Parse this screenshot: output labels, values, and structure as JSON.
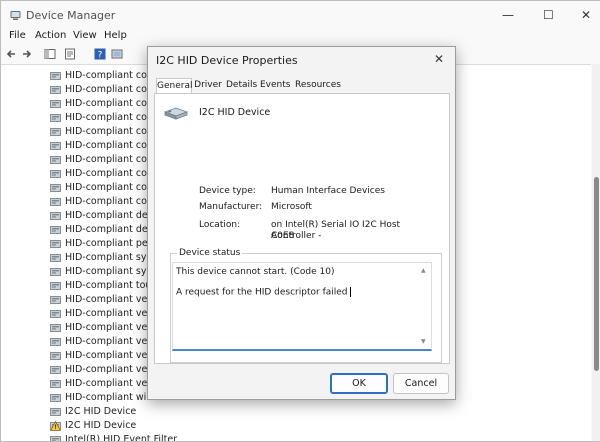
{
  "window": {
    "title": "Device Manager",
    "minimize_icon": "—",
    "maximize_icon": "☐",
    "close_icon": "✕"
  },
  "menu": [
    "File",
    "Action",
    "View",
    "Help"
  ],
  "tree_rows": [
    {
      "label": "HID-compliant consu",
      "warning": false
    },
    {
      "label": "HID-compliant consu",
      "warning": false
    },
    {
      "label": "HID-compliant consu",
      "warning": false
    },
    {
      "label": "HID-compliant consu",
      "warning": false
    },
    {
      "label": "HID-compliant consu",
      "warning": false
    },
    {
      "label": "HID-compliant consu",
      "warning": false
    },
    {
      "label": "HID-compliant consu",
      "warning": false
    },
    {
      "label": "HID-compliant consu",
      "warning": false
    },
    {
      "label": "HID-compliant consu",
      "warning": false
    },
    {
      "label": "HID-compliant consu",
      "warning": false
    },
    {
      "label": "HID-compliant devic",
      "warning": false
    },
    {
      "label": "HID-compliant devic",
      "warning": false
    },
    {
      "label": "HID-compliant pen",
      "warning": false
    },
    {
      "label": "HID-compliant syste",
      "warning": false
    },
    {
      "label": "HID-compliant syste",
      "warning": false
    },
    {
      "label": "HID-compliant touch",
      "warning": false
    },
    {
      "label": "HID-compliant vendo",
      "warning": false
    },
    {
      "label": "HID-compliant vendo",
      "warning": false
    },
    {
      "label": "HID-compliant vendo",
      "warning": false
    },
    {
      "label": "HID-compliant vendo",
      "warning": false
    },
    {
      "label": "HID-compliant vendo",
      "warning": false
    },
    {
      "label": "HID-compliant vendo",
      "warning": false
    },
    {
      "label": "HID-compliant vendo",
      "warning": false
    },
    {
      "label": "HID-compliant wirele",
      "warning": false
    },
    {
      "label": "I2C HID Device",
      "warning": false
    },
    {
      "label": "I2C HID Device",
      "warning": true
    },
    {
      "label": "Intel(R) HID Event Filter",
      "warning": false
    }
  ],
  "dialog": {
    "title": "I2C HID Device Properties",
    "close_icon": "✕",
    "tabs": [
      "General",
      "Driver",
      "Details",
      "Events",
      "Resources"
    ],
    "active_tab": "General",
    "device_name": "I2C HID Device",
    "props": {
      "type_label": "Device type:",
      "type_value": "Human Interface Devices",
      "mfr_label": "Manufacturer:",
      "mfr_value": "Microsoft",
      "loc_label": "Location:",
      "loc_value_1": "on Intel(R) Serial IO I2C Host Controller -",
      "loc_value_2": "A0E8"
    },
    "status": {
      "group_title": "Device status",
      "line1": "This device cannot start. (Code 10)",
      "line2": "A request for the HID descriptor failed"
    },
    "buttons": {
      "ok": "OK",
      "cancel": "Cancel"
    }
  },
  "colors": {
    "accent": "#2d6fc2",
    "warning": "#f2c94c"
  }
}
